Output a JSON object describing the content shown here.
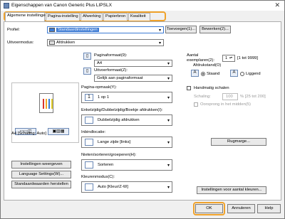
{
  "window": {
    "title": "Eigenschappen van Canon Generic Plus LIPSLX",
    "close_glyph": "✕"
  },
  "tabs": [
    "Algemene instellingen",
    "Pagina-instelling",
    "Afwerking",
    "Papierbron",
    "Kwaliteit"
  ],
  "profile": {
    "label": "Profiel:",
    "value": "Standaardinstellingen",
    "add_button": "Toevoegen(1)...",
    "edit_button": "Bewerken(2)..."
  },
  "output": {
    "label": "Uitvoermodus:",
    "value": "Afdrukken"
  },
  "paper": {
    "label": "Paginaformaat(9):",
    "value": "A4",
    "output_size_label": "Uitvoerformaat(Z):",
    "output_size_value": "Gelijk aan paginaformaat"
  },
  "copies": {
    "label": "Aantal exemplaren(2):",
    "value": "1",
    "range": "[1 tot 9999]"
  },
  "orientation": {
    "label": "Afdrukstand(O)",
    "portrait": "Staand",
    "landscape": "Liggend"
  },
  "layout": {
    "label": "Pagina-opmaak(Y):",
    "value": "1 op 1"
  },
  "manual_scale": {
    "label": "Handmatig schalen",
    "scaling_label": "Schaling:",
    "scaling_value": "100",
    "scaling_range": "% [25 tot 200]",
    "origin_label": "Oorsprong in het midden(5)"
  },
  "duplex": {
    "label": "Enkelzijdig/Dubbelzijdig/Boekje afdrukken(I):",
    "value": "Dubbelzijdig afdrukken"
  },
  "binding": {
    "label": "Inbindlocatie:",
    "value": "Lange zijde [links]",
    "gutter_button": "Rugmarge..."
  },
  "staple": {
    "label": "Nieten/sorteren/groeperen(H):",
    "value": "Sorteren"
  },
  "color": {
    "label": "Kleurenmodus(C):",
    "value": "Auto [Kleur/Z-W]",
    "copies_settings_button": "Instellingen voor aantal kleuren..."
  },
  "preview": {
    "caption": "A4 [Schaling: Auto]",
    "colors": [
      "#d9342b",
      "#f5a623",
      "#3b7bd4",
      "#e6d02a"
    ]
  },
  "left_buttons": {
    "show_settings": "Instellingen weergeven",
    "language": "Language Settings(W)...",
    "restore": "Standaardwaarden herstellen"
  },
  "footer": {
    "ok": "OK",
    "cancel": "Annuleren",
    "help": "Help"
  },
  "accent": "#f0a22a"
}
